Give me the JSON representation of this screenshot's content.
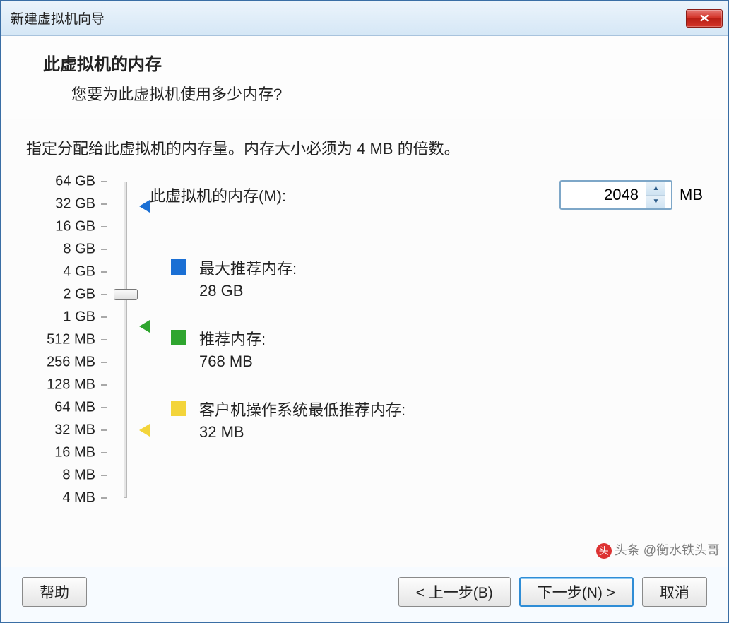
{
  "window_title": "新建虚拟机向导",
  "header": {
    "title": "此虚拟机的内存",
    "subtitle": "您要为此虚拟机使用多少内存?"
  },
  "instruction": "指定分配给此虚拟机的内存量。内存大小必须为 4 MB 的倍数。",
  "memory_label": "此虚拟机的内存(M):",
  "memory_value": "2048",
  "memory_unit": "MB",
  "ticks": [
    "64 GB",
    "32 GB",
    "16 GB",
    "8 GB",
    "4 GB",
    "2 GB",
    "1 GB",
    "512 MB",
    "256 MB",
    "128 MB",
    "64 MB",
    "32 MB",
    "16 MB",
    "8 MB",
    "4 MB"
  ],
  "markers": {
    "max": {
      "label": "最大推荐内存:",
      "value": "28 GB",
      "color": "#1a6fd4"
    },
    "rec": {
      "label": "推荐内存:",
      "value": "768 MB",
      "color": "#2fa52f"
    },
    "min": {
      "label": "客户机操作系统最低推荐内存:",
      "value": "32 MB",
      "color": "#f3d43a"
    }
  },
  "buttons": {
    "help": "帮助",
    "back": "< 上一步(B)",
    "next": "下一步(N) >",
    "cancel": "取消"
  },
  "watermark": "头条 @衡水铁头哥"
}
